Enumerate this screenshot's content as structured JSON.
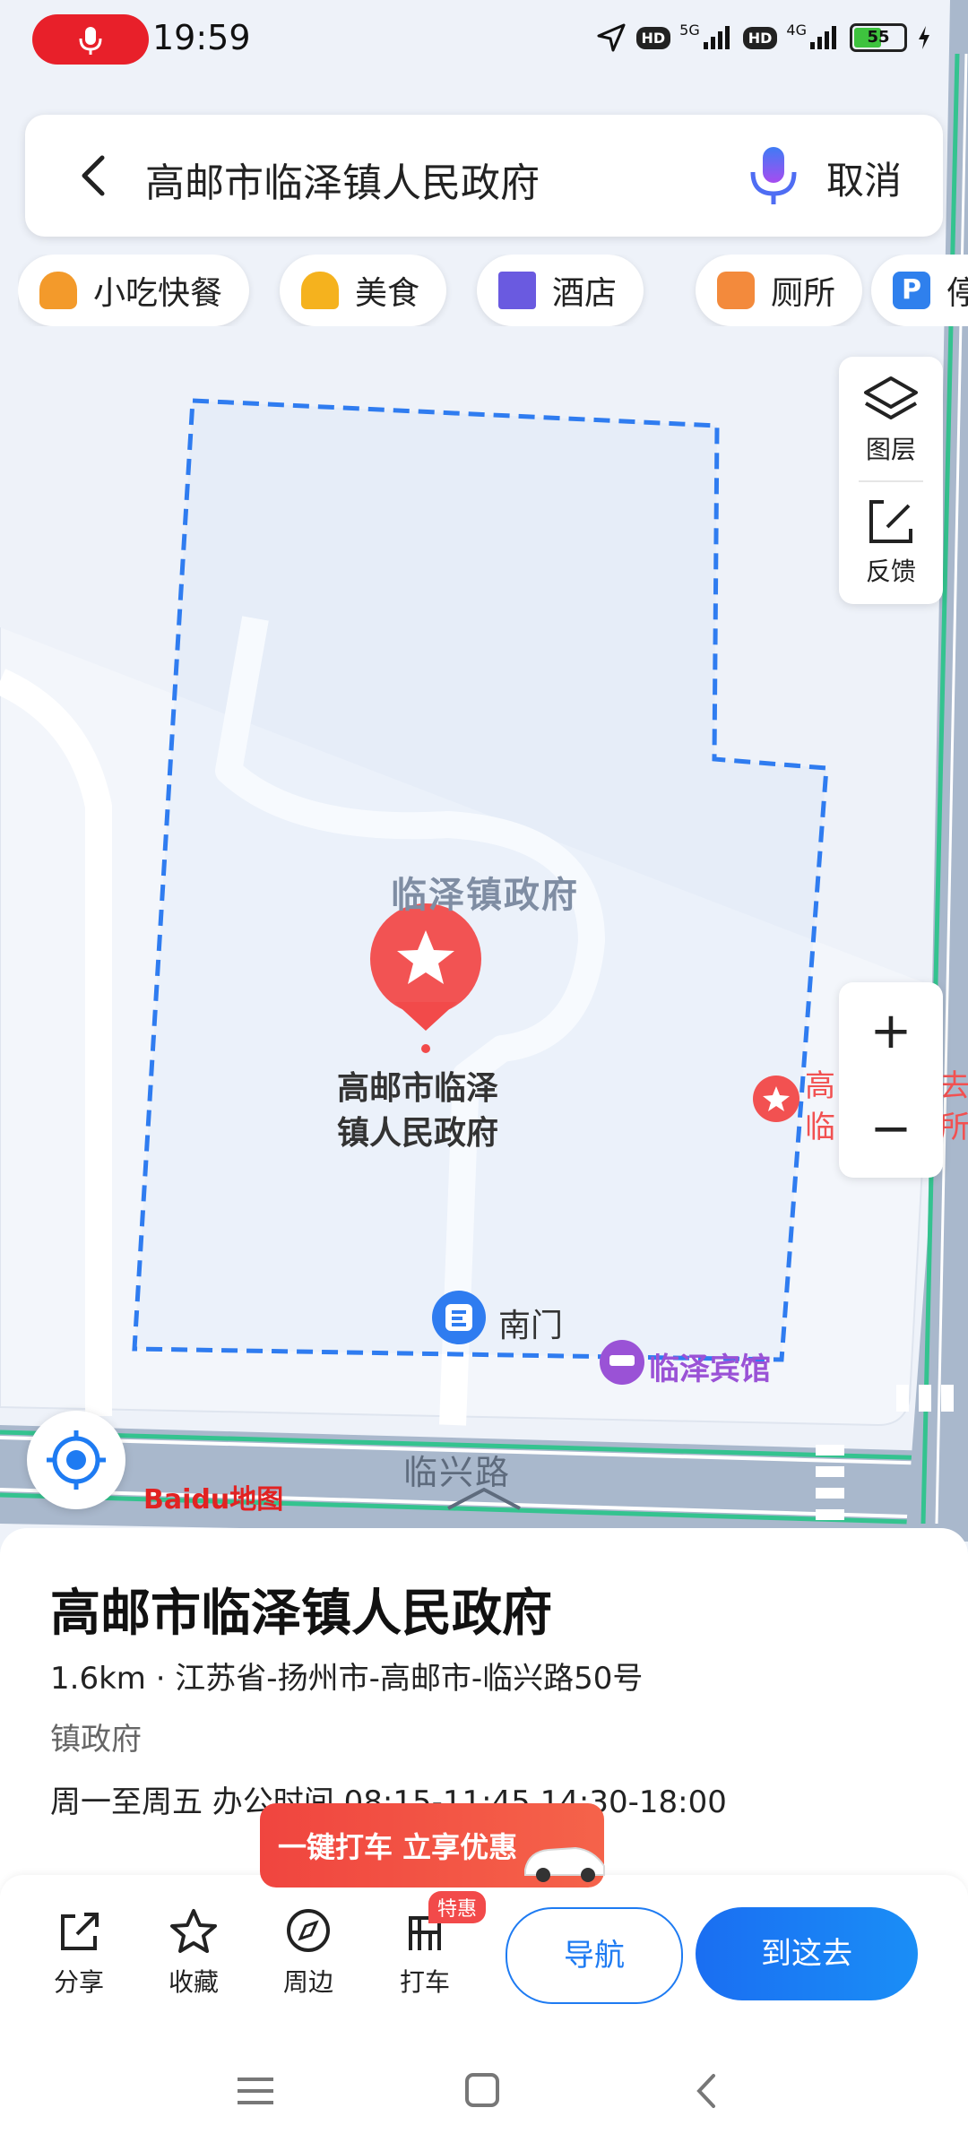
{
  "status_bar": {
    "time": "19:59",
    "battery": "55",
    "net1": "5G",
    "net2": "4G",
    "hd": "HD"
  },
  "search": {
    "query": "高邮市临泽镇人民政府",
    "cancel_label": "取消"
  },
  "categories": [
    {
      "label": "小吃快餐",
      "icon": "burger-icon",
      "color": "#f39a2b"
    },
    {
      "label": "美食",
      "icon": "food-icon",
      "color": "#f5b21e"
    },
    {
      "label": "酒店",
      "icon": "hotel-icon",
      "color": "#6a5ae0"
    },
    {
      "label": "厕所",
      "icon": "toilet-icon",
      "color": "#f38a3c"
    },
    {
      "label": "停",
      "icon": "parking-icon",
      "color": "#2f80ed"
    }
  ],
  "map_tools": {
    "layers_label": "图层",
    "feedback_label": "反馈",
    "zoom_in": "+",
    "zoom_out": "−"
  },
  "map": {
    "area_label": "临泽镇政府",
    "poi_label_line1": "高邮市临泽",
    "poi_label_line2": "镇人民政府",
    "gate_label": "南门",
    "hotel_label": "临泽宾馆",
    "road_label": "临兴路",
    "partial_label_1a": "高",
    "partial_label_1b": "去",
    "partial_label_2a": "临",
    "partial_label_2b": "所",
    "brand": "Baidu地图",
    "accent": "#1e7bf2",
    "boundary_color": "#2f7cf0",
    "road_edge_color": "#34c38f"
  },
  "place": {
    "title": "高邮市临泽镇人民政府",
    "address": "1.6km · 江苏省-扬州市-高邮市-临兴路50号",
    "category": "镇政府",
    "hours": "周一至周五 办公时间 08:15-11:45,14:30-18:00"
  },
  "promo": {
    "text": "一键打车 立享优惠",
    "tag": "特惠"
  },
  "actions": {
    "share": "分享",
    "favorite": "收藏",
    "nearby": "周边",
    "taxi": "打车",
    "navigate": "导航",
    "go_here": "到这去"
  }
}
